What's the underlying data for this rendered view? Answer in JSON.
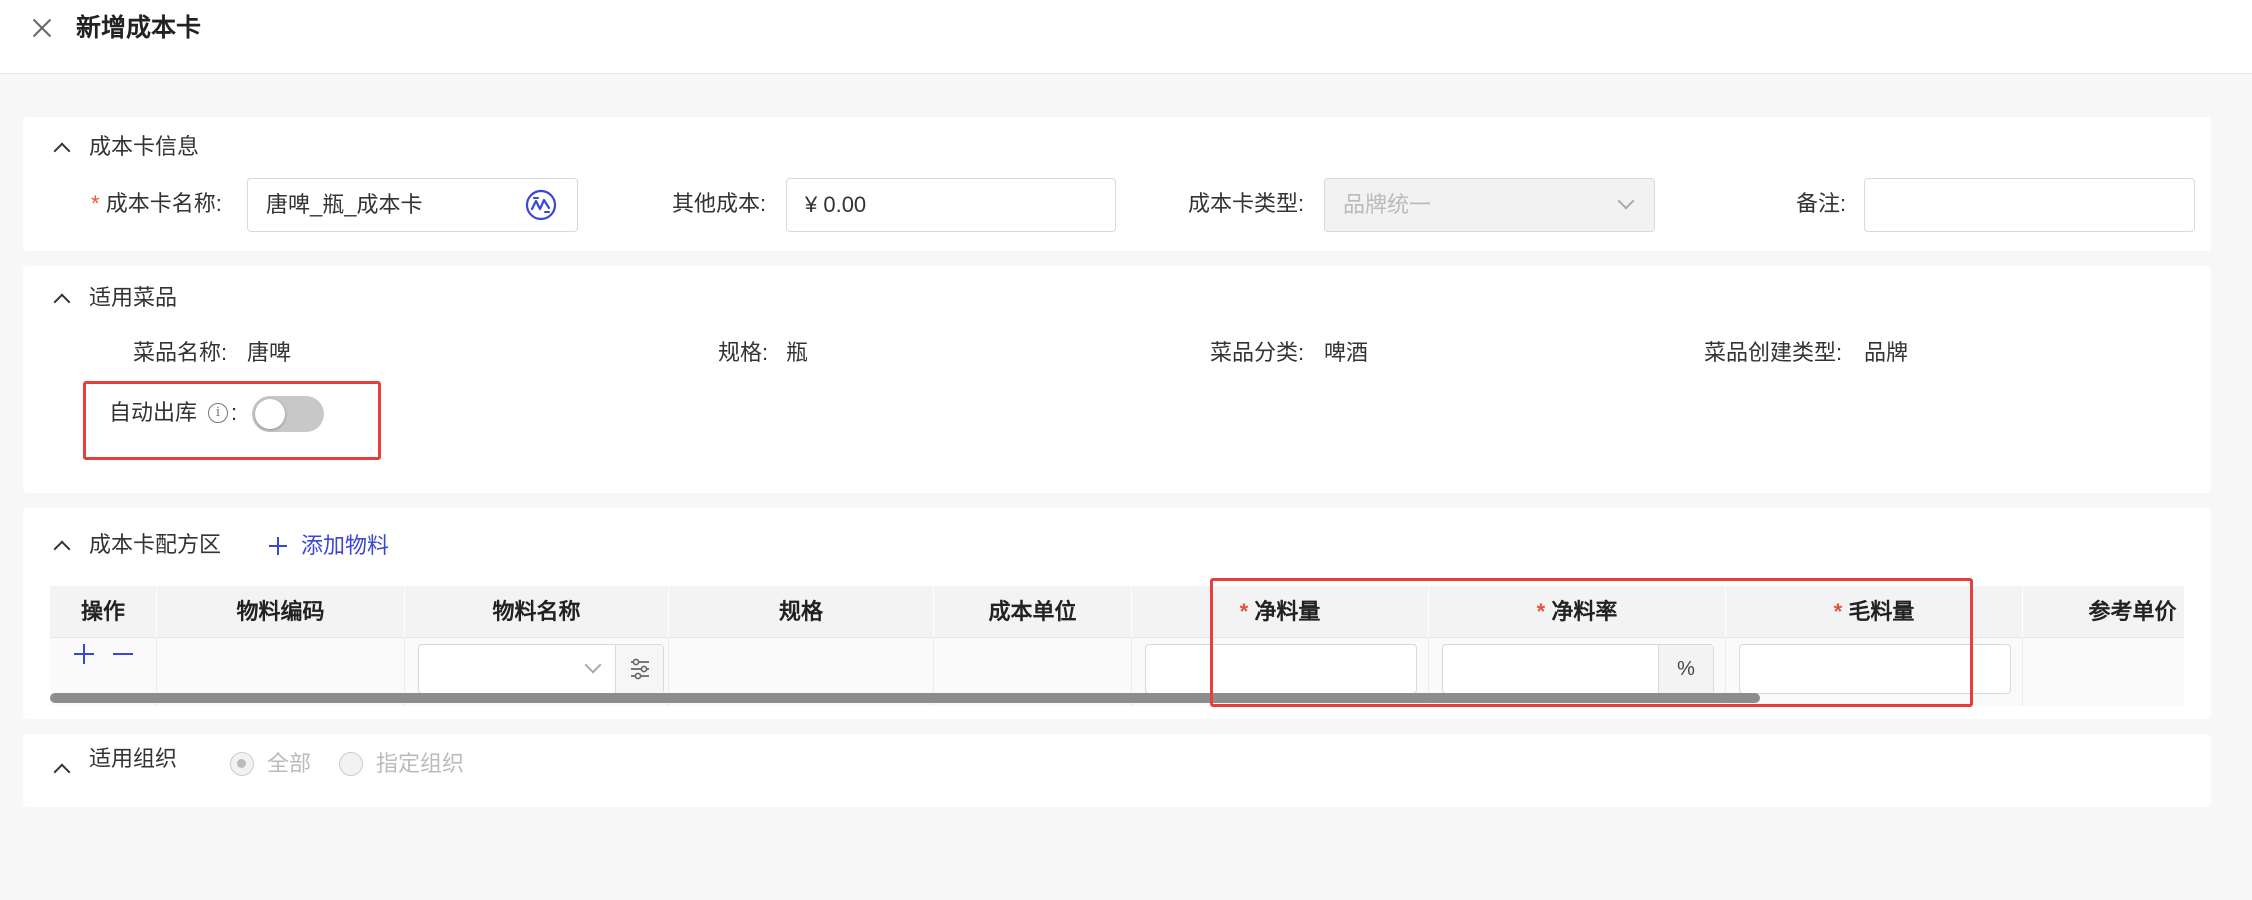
{
  "header": {
    "title": "新增成本卡"
  },
  "cost_card_info": {
    "section_title": "成本卡信息",
    "name_label": "成本卡名称:",
    "name_value": "唐啤_瓶_成本卡",
    "other_cost_label": "其他成本:",
    "other_cost_value": "¥ 0.00",
    "type_label": "成本卡类型:",
    "type_value": "品牌统一",
    "remark_label": "备注:",
    "remark_value": ""
  },
  "dishes": {
    "section_title": "适用菜品",
    "dish_name_label": "菜品名称:",
    "dish_name_value": "唐啤",
    "spec_label": "规格:",
    "spec_value": "瓶",
    "category_label": "菜品分类:",
    "category_value": "啤酒",
    "create_type_label": "菜品创建类型:",
    "create_type_value": "品牌",
    "auto_out_label": "自动出库",
    "auto_out_colon": ":",
    "auto_out_enabled": false,
    "info_glyph": "i"
  },
  "recipe": {
    "section_title": "成本卡配方区",
    "add_button": "添加物料",
    "columns": [
      "操作",
      "物料编码",
      "物料名称",
      "规格",
      "成本单位",
      "净料量",
      "净料率",
      "毛料量",
      "参考单价"
    ],
    "required_mark": "*",
    "percent_suffix": "%"
  },
  "org": {
    "section_title": "适用组织",
    "options": [
      "全部",
      "指定组织"
    ],
    "selected": "全部"
  },
  "colors": {
    "accent": "#3a46d8",
    "required": "#e5533a",
    "highlight_box": "#e5403a"
  }
}
